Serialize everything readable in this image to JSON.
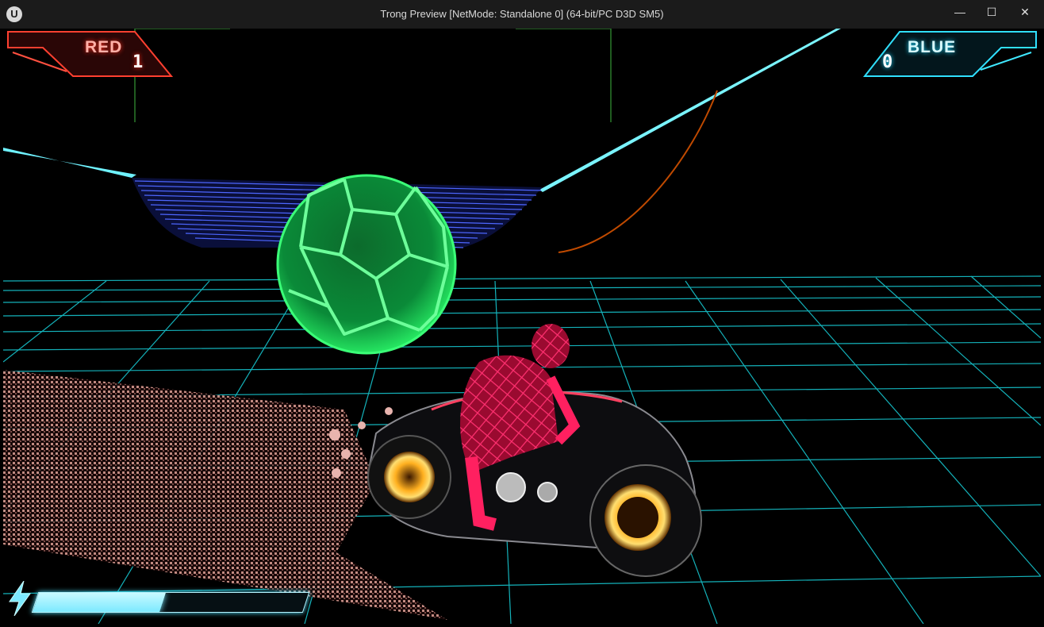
{
  "window": {
    "title": "Trong Preview [NetMode: Standalone 0]  (64-bit/PC D3D SM5)",
    "minimize_glyph": "—",
    "maximize_glyph": "☐",
    "close_glyph": "✕",
    "logo_glyph": "U"
  },
  "hud": {
    "red_team": {
      "label": "RED",
      "score": "1",
      "color": "#ff3b30"
    },
    "blue_team": {
      "label": "BLUE",
      "score": "0",
      "color": "#30e0ff"
    },
    "boost": {
      "level": 0.47,
      "icon": "lightning-bolt-icon",
      "color": "#7ce9ff"
    }
  },
  "scene": {
    "ball": {
      "icon": "soccer-ball",
      "color": "#29ff6a"
    },
    "grid_color": "#17c6cf",
    "goal_color": "#3a55ff",
    "rider_color": "#ff2060"
  }
}
